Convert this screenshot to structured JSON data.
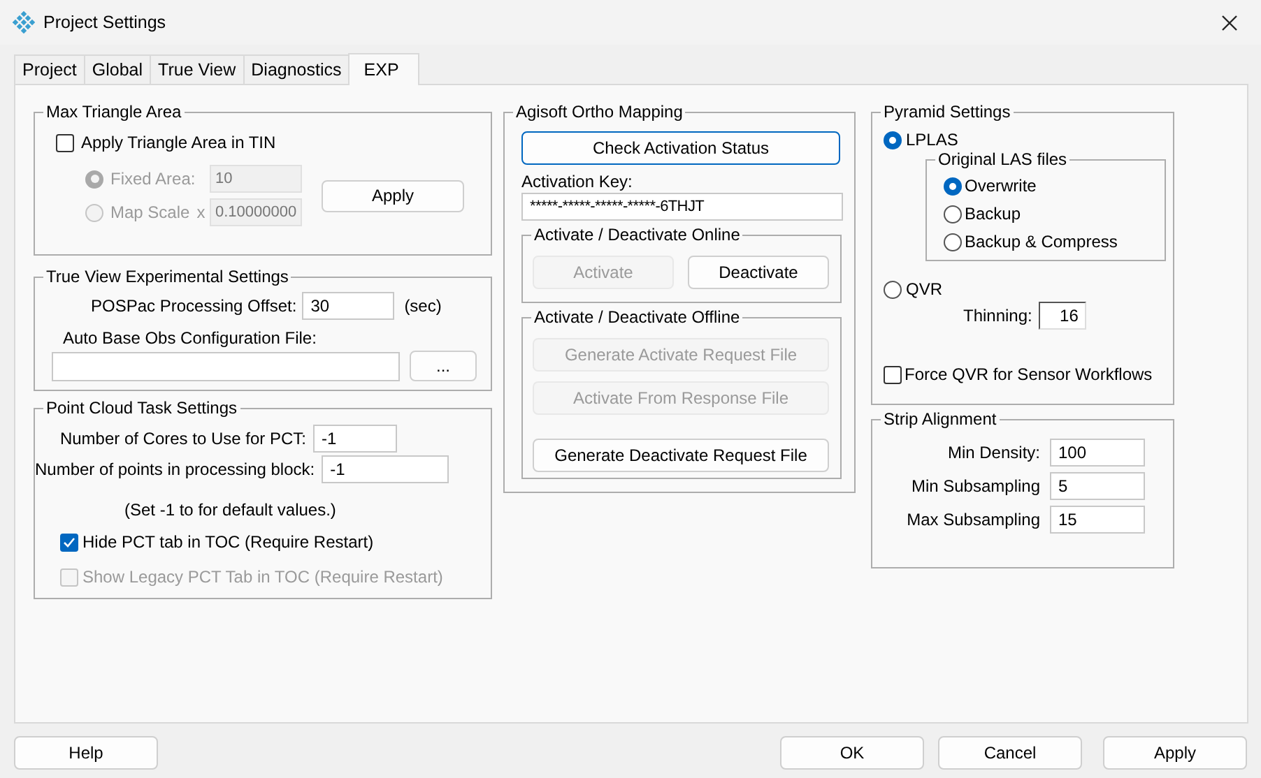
{
  "window": {
    "title": "Project Settings"
  },
  "tabs": [
    {
      "label": "Project",
      "selected": false
    },
    {
      "label": "Global",
      "selected": false
    },
    {
      "label": "True View",
      "selected": false
    },
    {
      "label": "Diagnostics",
      "selected": false
    },
    {
      "label": "EXP",
      "selected": true
    }
  ],
  "max_triangle_area": {
    "title": "Max Triangle Area",
    "apply_in_tin": {
      "label": "Apply Triangle Area in TIN",
      "checked": false,
      "disabled": false
    },
    "options": [
      {
        "label": "Fixed Area:",
        "value": "10",
        "selected": true,
        "disabled": true
      },
      {
        "label": "Map Scale",
        "suffix": "x",
        "value": "0.10000000",
        "selected": false,
        "disabled": true
      }
    ],
    "apply_button": {
      "label": "Apply",
      "disabled": false
    }
  },
  "true_view": {
    "title": "True View Experimental Settings",
    "offset_label": "POSPac Processing Offset:",
    "offset_value": "30",
    "offset_unit": "(sec)",
    "config_label": "Auto Base Obs Configuration File:",
    "browse_button": {
      "label": "...",
      "disabled": false
    }
  },
  "point_cloud": {
    "title": "Point Cloud Task Settings",
    "fields": [
      {
        "label": "Number of Cores to Use for PCT:",
        "value": "-1"
      },
      {
        "label": "Number of points in processing block:",
        "value": "-1"
      }
    ],
    "note": "(Set -1 to for default values.)",
    "checks": [
      {
        "label": "Hide PCT tab in TOC (Require Restart)",
        "checked": true,
        "disabled": false
      },
      {
        "label": "Show Legacy PCT Tab in TOC (Require Restart)",
        "checked": false,
        "disabled": true
      }
    ]
  },
  "ortho": {
    "title": "Agisoft Ortho Mapping",
    "check_button": {
      "label": "Check Activation Status",
      "disabled": false
    },
    "key_label": "Activation Key:",
    "key_value": "*****-*****-*****-*****-6THJT",
    "online": {
      "title": "Activate / Deactivate Online",
      "buttons": [
        {
          "label": "Activate",
          "disabled": true
        },
        {
          "label": "Deactivate",
          "disabled": false
        }
      ]
    },
    "offline": {
      "title": "Activate / Deactivate Offline",
      "buttons": [
        {
          "label": "Generate Activate Request File",
          "disabled": true
        },
        {
          "label": "Activate From Response File",
          "disabled": true
        },
        {
          "label": "Generate Deactivate Request File",
          "disabled": false
        }
      ]
    }
  },
  "pyramid": {
    "title": "Pyramid Settings",
    "lplas": {
      "label": "LPLAS",
      "selected": true
    },
    "las_files": {
      "title": "Original LAS files",
      "options": [
        {
          "label": "Overwrite",
          "selected": true
        },
        {
          "label": "Backup",
          "selected": false
        },
        {
          "label": "Backup & Compress",
          "selected": false
        }
      ]
    },
    "qvr": {
      "label": "QVR",
      "selected": false
    },
    "thinning_label": "Thinning:",
    "thinning_value": "16",
    "force_qvr": {
      "label": "Force QVR for Sensor Workflows",
      "checked": false,
      "disabled": false
    }
  },
  "strip_alignment": {
    "title": "Strip Alignment",
    "fields": [
      {
        "label": "Min Density:",
        "value": "100"
      },
      {
        "label": "Min Subsampling",
        "value": "5"
      },
      {
        "label": "Max Subsampling",
        "value": "15"
      }
    ]
  },
  "footer": {
    "buttons": [
      {
        "label": "Help"
      },
      {
        "label": "OK"
      },
      {
        "label": "Cancel"
      },
      {
        "label": "Apply"
      }
    ]
  }
}
